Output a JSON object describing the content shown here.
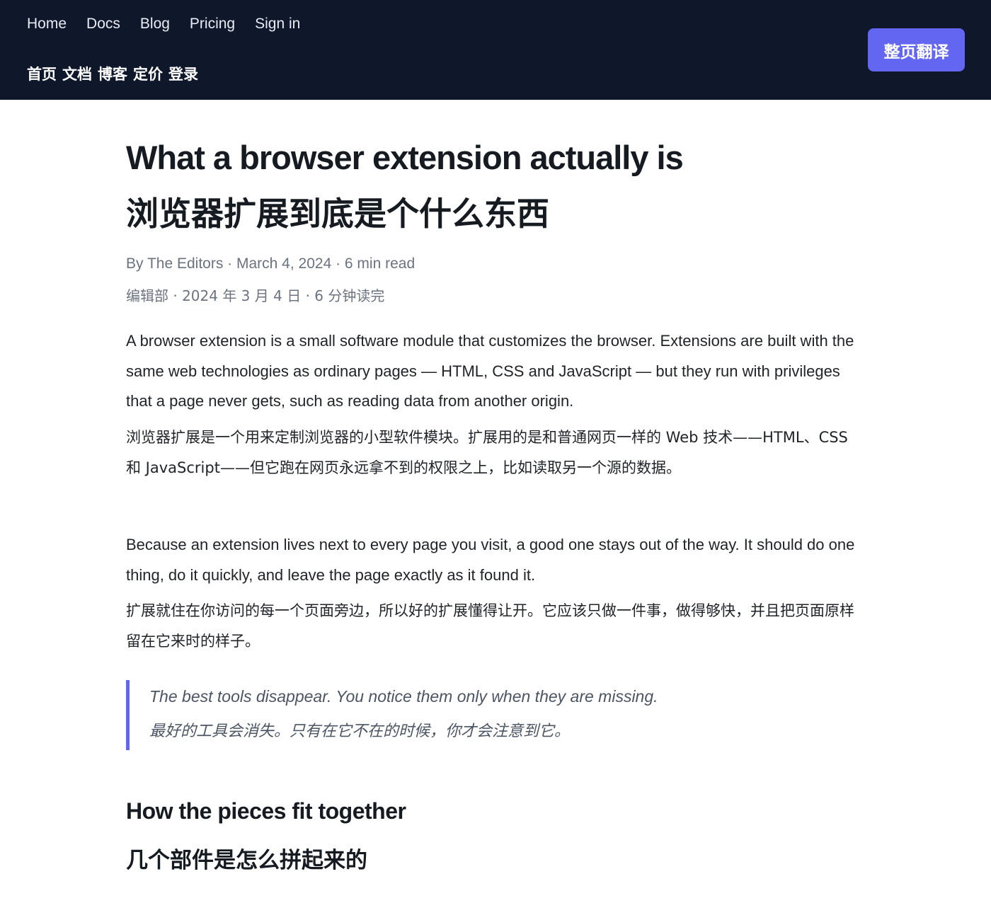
{
  "nav": {
    "en": [
      "Home",
      "Docs",
      "Blog",
      "Pricing",
      "Sign in"
    ],
    "zh": [
      "首页",
      "文档",
      "博客",
      "定价",
      "登录"
    ]
  },
  "translate_button": "整页翻译",
  "article": {
    "title_en": "What a browser extension actually is",
    "title_zh": "浏览器扩展到底是个什么东西",
    "meta_en": "By The Editors · March 4, 2024 · 6 min read",
    "meta_zh": "编辑部 · 2024 年 3 月 4 日 · 6 分钟读完",
    "p1_en": "A browser extension is a small software module that customizes the browser. Extensions are built with the same web technologies as ordinary pages — HTML, CSS and JavaScript — but they run with privileges that a page never gets, such as reading data from another origin.",
    "p1_zh": "浏览器扩展是一个用来定制浏览器的小型软件模块。扩展用的是和普通网页一样的 Web 技术——HTML、CSS 和 JavaScript——但它跑在网页永远拿不到的权限之上，比如读取另一个源的数据。",
    "p2_en": "Because an extension lives next to every page you visit, a good one stays out of the way. It should do one thing, do it quickly, and leave the page exactly as it found it.",
    "p2_zh": "扩展就住在你访问的每一个页面旁边，所以好的扩展懂得让开。它应该只做一件事，做得够快，并且把页面原样留在它来时的样子。",
    "quote_en": "The best tools disappear. You notice them only when they are missing.",
    "quote_zh": "最好的工具会消失。只有在它不在的时候，你才会注意到它。",
    "h2_en": "How the pieces fit together",
    "h2_zh": "几个部件是怎么拼起来的"
  },
  "colors": {
    "topbar": "#0f172a",
    "accent": "#6366f1",
    "meta": "#6b7280"
  }
}
